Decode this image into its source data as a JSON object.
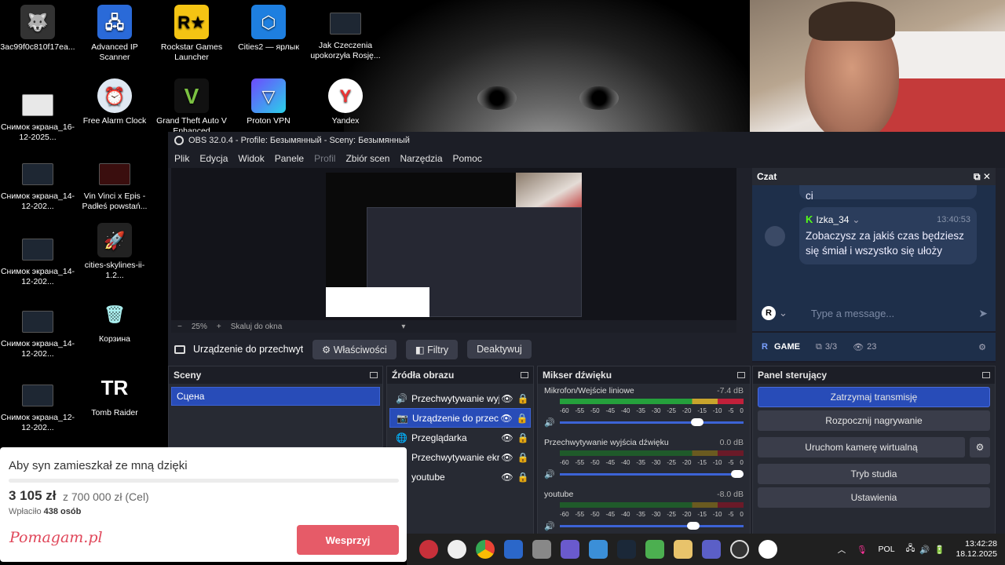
{
  "desktop": {
    "icons": [
      {
        "label": "3ac99f0c810f17ea..."
      },
      {
        "label": "Advanced IP Scanner"
      },
      {
        "label": "Rockstar Games Launcher"
      },
      {
        "label": "Cities2 — ярлык"
      },
      {
        "label": "Jak Czeczenia upokorzyła Rosję..."
      },
      {
        "label": "Снимок экрана_16-12-2025..."
      },
      {
        "label": "Free Alarm Clock"
      },
      {
        "label": "Grand Theft Auto V Enhanced"
      },
      {
        "label": "Proton VPN"
      },
      {
        "label": "Yandex"
      },
      {
        "label": "Снимок экрана_14-12-202..."
      },
      {
        "label": "Vin Vinci x Epis - Padłeś powstań..."
      },
      {
        "label": "Снимок экрана_14-12-202..."
      },
      {
        "label": "cities-skylines-ii-1.2..."
      },
      {
        "label": "Снимок экрана_14-12-202..."
      },
      {
        "label": "Корзина"
      },
      {
        "label": "Снимок экрана_12-12-202..."
      },
      {
        "label": "Tomb Raider"
      }
    ]
  },
  "obs": {
    "title": "OBS 32.0.4 - Profile: Безымянный - Sceny: Безымянный",
    "menu": [
      "Plik",
      "Edycja",
      "Widok",
      "Panele",
      "Profil",
      "Zbiór scen",
      "Narzędzia",
      "Pomoc"
    ],
    "zoom": {
      "minus": "−",
      "value": "25%",
      "plus": "+",
      "fit": "Skaluj do okna"
    },
    "source_bar": {
      "source_name": "Urządzenie do przechwyty",
      "properties": "Właściwości",
      "filters": "Filtry",
      "deactivate": "Deaktywuj"
    },
    "scenes": {
      "title": "Sceny",
      "items": [
        "Сцена"
      ]
    },
    "sources": {
      "title": "Źródła obrazu",
      "items": [
        {
          "name": "Przechwytywanie wyjś"
        },
        {
          "name": "Urządzenie do przech"
        },
        {
          "name": "Przeglądarka"
        },
        {
          "name": "Przechwytywanie ekra"
        },
        {
          "name": "youtube"
        }
      ]
    },
    "mixer": {
      "title": "Mikser dźwięku",
      "scale": [
        "-60",
        "-55",
        "-50",
        "-45",
        "-40",
        "-35",
        "-30",
        "-25",
        "-20",
        "-15",
        "-10",
        "-5",
        "0"
      ],
      "channels": [
        {
          "name": "Mikrofon/Wejście liniowe",
          "db": "-7.4 dB",
          "level": 0.78
        },
        {
          "name": "Przechwytywanie wyjścia dźwięku",
          "db": "0.0 dB",
          "level": 1.0
        },
        {
          "name": "youtube",
          "db": "-8.0 dB",
          "level": 0.76
        }
      ]
    },
    "controls": {
      "title": "Panel sterujący",
      "buttons": [
        "Zatrzymaj transmisję",
        "Rozpocznij nagrywanie",
        "Uruchom kamerę wirtualną",
        "Tryb studia",
        "Ustawienia"
      ]
    },
    "chat": {
      "title": "Czat",
      "partial_prev": "ci",
      "message": {
        "user": "Izka_34",
        "time": "13:40:53",
        "text": "Zobaczysz za jakiś czas będziesz się śmiał i wszystko się ułoży"
      },
      "input_placeholder": "Type a message...",
      "footer": {
        "category": "GAME",
        "mods": "3/3",
        "viewers": "23"
      }
    }
  },
  "donation": {
    "title": "Aby syn zamieszkał ze mną dzięki",
    "amount": "3 105 zł",
    "goal": "z 700 000 zł (Cel)",
    "donors_prefix": "Wpłaciło",
    "donors_count": "438 osób",
    "logo": "Pomagam.pl",
    "button": "Wesprzyj"
  },
  "taskbar": {
    "lang": "POL",
    "time": "13:42:28",
    "date": "18.12.2025"
  },
  "colors": {
    "obs_bg": "#1f212a",
    "obs_accent": "#284cb8",
    "kick_green": "#53fc18",
    "donate_red": "#e65b68"
  }
}
